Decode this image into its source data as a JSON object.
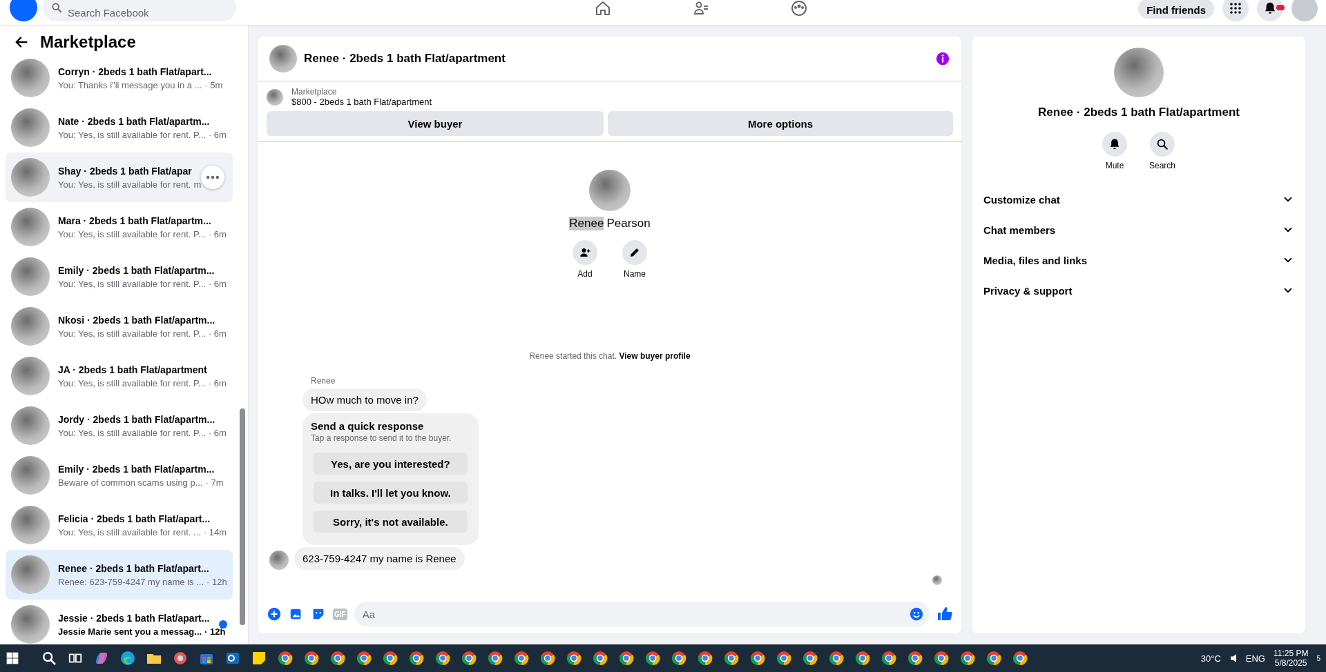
{
  "header": {
    "search": {
      "placeholder": "Search Facebook"
    },
    "find_friends": "Find friends",
    "notifications_badge": true
  },
  "sidebar": {
    "title": "Marketplace",
    "conversations": [
      {
        "name": "Corryn · 2beds 1 bath Flat/apart...",
        "snippet": "You: Thanks i\"il message you in a ...",
        "time": "· 5m",
        "selected": false,
        "hovered": false,
        "unread": false
      },
      {
        "name": "Nate · 2beds 1 bath Flat/apartm...",
        "snippet": "You: Yes, is still available for rent. P...",
        "time": "· 6m",
        "selected": false,
        "hovered": false,
        "unread": false
      },
      {
        "name": "Shay · 2beds 1 bath Flat/apar",
        "snippet": "You: Yes, is still available for rent.",
        "time": "m",
        "selected": false,
        "hovered": true,
        "unread": false
      },
      {
        "name": "Mara · 2beds 1 bath Flat/apartm...",
        "snippet": "You: Yes, is still available for rent. P...",
        "time": "· 6m",
        "selected": false,
        "hovered": false,
        "unread": false
      },
      {
        "name": "Emily · 2beds 1 bath Flat/apartm...",
        "snippet": "You: Yes, is still available for rent. P...",
        "time": "· 6m",
        "selected": false,
        "hovered": false,
        "unread": false
      },
      {
        "name": "Nkosi · 2beds 1 bath Flat/apartm...",
        "snippet": "You: Yes, is still available for rent. P...",
        "time": "· 6m",
        "selected": false,
        "hovered": false,
        "unread": false
      },
      {
        "name": "JA · 2beds 1 bath Flat/apartment",
        "snippet": "You: Yes, is still available for rent. P...",
        "time": "· 6m",
        "selected": false,
        "hovered": false,
        "unread": false
      },
      {
        "name": "Jordy · 2beds 1 bath Flat/apartm...",
        "snippet": "You: Yes, is still available for rent. P...",
        "time": "· 6m",
        "selected": false,
        "hovered": false,
        "unread": false
      },
      {
        "name": "Emily · 2beds 1 bath Flat/apartm...",
        "snippet": "Beware of common scams using p...",
        "time": "· 7m",
        "selected": false,
        "hovered": false,
        "unread": false
      },
      {
        "name": "Felicia · 2beds 1 bath Flat/apart...",
        "snippet": "You: Yes, is still available for rent. ...",
        "time": "· 14m",
        "selected": false,
        "hovered": false,
        "unread": false
      },
      {
        "name": "Renee · 2beds 1 bath Flat/apart...",
        "snippet": "Renee: 623-759-4247 my name is ...",
        "time": "· 12h",
        "selected": true,
        "hovered": false,
        "unread": false
      },
      {
        "name": "Jessie · 2beds 1 bath Flat/apart...",
        "snippet": "Jessie Marie sent you a messag...",
        "time": "· 12h",
        "selected": false,
        "hovered": false,
        "unread": true
      }
    ]
  },
  "chat": {
    "title": "Renee · 2beds 1 bath Flat/apartment",
    "listing": {
      "source": "Marketplace",
      "title": "$800 - 2beds 1 bath Flat/apartment"
    },
    "buttons": [
      "View buyer",
      "More options"
    ],
    "profile": {
      "name_parts": [
        {
          "text": "Renee",
          "highlighted": true
        },
        {
          "text": "Pearson",
          "highlighted": false
        }
      ],
      "actions": [
        {
          "kind": "add",
          "label": "Add"
        },
        {
          "kind": "edit",
          "label": "Name"
        }
      ]
    },
    "started": {
      "text": "Renee started this chat.",
      "link": "View buyer profile"
    },
    "sender": "Renee",
    "messages": [
      {
        "kind": "text",
        "text": "HOw much to move in?",
        "avatar": false
      },
      {
        "kind": "quick",
        "title": "Send a quick response",
        "subtitle": "Tap a response to send it to the buyer.",
        "options": [
          "Yes, are you interested?",
          "In talks. I'll let you know.",
          "Sorry, it's not available."
        ]
      },
      {
        "kind": "text",
        "text": "623-759-4247  my name is Renee",
        "avatar": true
      }
    ],
    "composer": {
      "gif": "GIF",
      "placeholder": "Aa"
    }
  },
  "details": {
    "title": "Renee · 2beds 1 bath Flat/apartment",
    "actions": [
      {
        "kind": "mute",
        "label": "Mute"
      },
      {
        "kind": "search",
        "label": "Search"
      }
    ],
    "sections": [
      {
        "label": "Customize chat",
        "expanded": false
      },
      {
        "label": "Chat members",
        "expanded": false
      },
      {
        "label": "Media, files and links",
        "expanded": false
      },
      {
        "label": "Privacy & support",
        "expanded": false
      }
    ]
  },
  "taskbar": {
    "apps": [
      {
        "kind": "search"
      },
      {
        "kind": "taskview"
      },
      {
        "kind": "copilot"
      },
      {
        "kind": "edge"
      },
      {
        "kind": "files"
      },
      {
        "kind": "app"
      },
      {
        "kind": "store"
      },
      {
        "kind": "outlook"
      },
      {
        "kind": "notes"
      },
      {
        "kind": "chrome"
      },
      {
        "kind": "chrome"
      },
      {
        "kind": "chrome"
      },
      {
        "kind": "chrome"
      },
      {
        "kind": "chrome"
      },
      {
        "kind": "chrome"
      },
      {
        "kind": "chrome"
      },
      {
        "kind": "chrome"
      },
      {
        "kind": "chrome"
      },
      {
        "kind": "chrome"
      },
      {
        "kind": "chrome"
      },
      {
        "kind": "chrome"
      },
      {
        "kind": "chrome"
      },
      {
        "kind": "chrome"
      },
      {
        "kind": "chrome"
      },
      {
        "kind": "chrome"
      },
      {
        "kind": "chrome"
      },
      {
        "kind": "chrome"
      },
      {
        "kind": "chrome"
      },
      {
        "kind": "chrome"
      },
      {
        "kind": "chrome"
      },
      {
        "kind": "chrome"
      },
      {
        "kind": "chrome"
      },
      {
        "kind": "chrome"
      },
      {
        "kind": "chrome"
      },
      {
        "kind": "chrome"
      },
      {
        "kind": "chrome"
      },
      {
        "kind": "chrome"
      },
      {
        "kind": "chrome"
      }
    ],
    "weather": "30°C",
    "language": "ENG",
    "time": "11:25 PM",
    "date": "5/8/2025",
    "notification_count": "5"
  }
}
